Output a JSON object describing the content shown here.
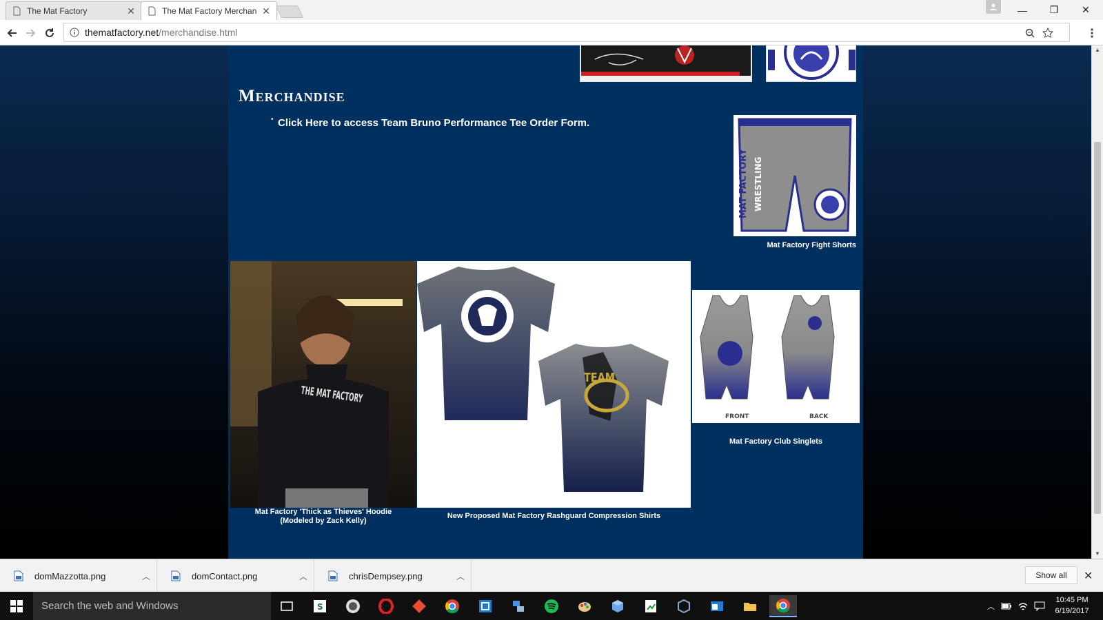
{
  "browser": {
    "tabs": [
      {
        "title": "The Mat Factory"
      },
      {
        "title": "The Mat Factory Merchan"
      }
    ],
    "url": {
      "host": "thematfactory.net",
      "path": "/merchandise.html"
    }
  },
  "page": {
    "title": "Merchandise",
    "order_link": "Click Here to access Team Bruno Performance Tee Order Form.",
    "products": [
      {
        "caption": "Mat Factory Fight Shorts"
      },
      {
        "caption_line1": "Mat Factory 'Thick as Thieves' Hoodie",
        "caption_line2": "(Modeled by Zack Kelly)"
      },
      {
        "caption": "New Proposed Mat Factory Rashguard Compression Shirts"
      },
      {
        "caption": "Mat Factory Club Singlets"
      }
    ],
    "image_text": {
      "shorts_side": "MAT FACTORY",
      "shorts_side2": "WRESTLING",
      "hoodie_print": "THE MAT FACTORY",
      "shirt_logo": "TEAM",
      "singlet_front": "FRONT",
      "singlet_back": "BACK"
    }
  },
  "downloads": {
    "items": [
      {
        "name": "domMazzotta.png"
      },
      {
        "name": "domContact.png"
      },
      {
        "name": "chrisDempsey.png"
      }
    ],
    "show_all": "Show all"
  },
  "taskbar": {
    "search_placeholder": "Search the web and Windows",
    "time": "10:45 PM",
    "date": "6/19/2017"
  },
  "colors": {
    "page_panel": "#00305f",
    "accent_link": "#ffffff"
  }
}
